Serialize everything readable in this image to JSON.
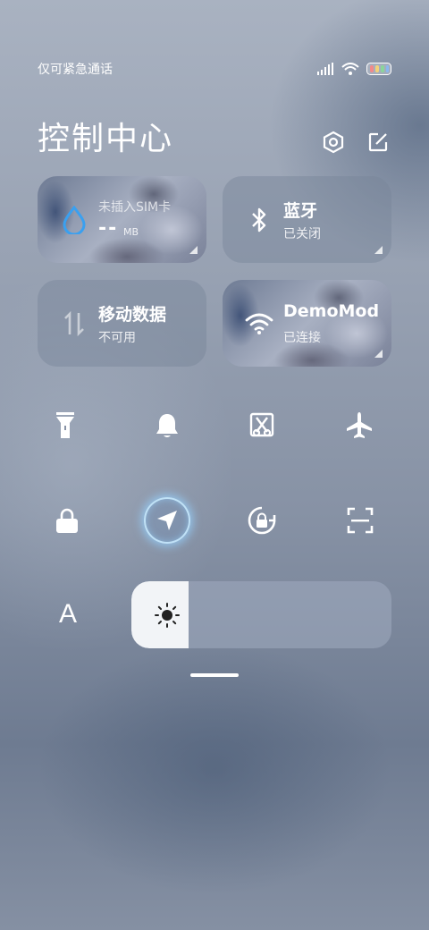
{
  "status_bar": {
    "carrier": "仅可紧急通话",
    "icons": [
      "signal-icon",
      "wifi-icon",
      "battery-icon"
    ]
  },
  "header": {
    "title": "控制中心",
    "actions": [
      "settings-icon",
      "edit-icon"
    ]
  },
  "tiles": {
    "data_usage": {
      "label": "未插入SIM卡",
      "value": "--",
      "unit": "MB",
      "icon": "water-drop-icon"
    },
    "bluetooth": {
      "label": "蓝牙",
      "status": "已关闭",
      "icon": "bluetooth-icon"
    },
    "mobile_data": {
      "label": "移动数据",
      "status": "不可用",
      "icon": "data-arrows-icon"
    },
    "wifi": {
      "label": "DemoMod",
      "status": "已连接",
      "icon": "wifi-icon"
    }
  },
  "toggles_row1": [
    "flashlight-icon",
    "bell-icon",
    "screenshot-icon",
    "airplane-icon"
  ],
  "toggles_row2": [
    "lock-icon",
    "location-icon",
    "rotation-lock-icon",
    "scan-icon"
  ],
  "brightness": {
    "font_label": "A",
    "level": 0.22
  },
  "colors": {
    "accent_blue": "#3aa0f0",
    "glow": "#96d2ff"
  }
}
